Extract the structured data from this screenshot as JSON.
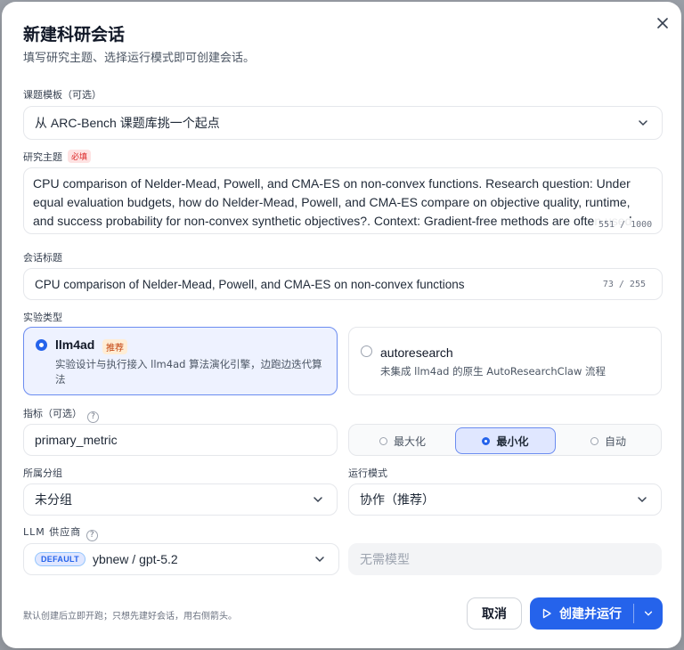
{
  "dialog": {
    "title": "新建科研会话",
    "subtitle": "填写研究主题、选择运行模式即可创建会话。"
  },
  "template": {
    "label": "课题模板（可选）",
    "value": "从 ARC-Bench 课题库挑一个起点"
  },
  "topic": {
    "label": "研究主题",
    "required": "必填",
    "text": "CPU comparison of Nelder-Mead, Powell, and CMA-ES on non-convex functions. Research question: Under equal evaluation budgets, how do Nelder-Mead, Powell, and CMA-ES compare on objective quality, runtime, and success probability for non-convex synthetic objectives?. Context: Gradient-free methods are often used when derivatives are unavailable or unreliable, and we need a reproducible comparison.",
    "counter": "551 / 1000"
  },
  "session_title": {
    "label": "会话标题",
    "value": "CPU comparison of Nelder-Mead, Powell, and CMA-ES on non-convex functions",
    "counter": "73 / 255"
  },
  "experiment": {
    "label": "实验类型",
    "options": [
      {
        "name": "llm4ad",
        "badge": "推荐",
        "desc": "实验设计与执行接入 llm4ad 算法演化引擎，边跑边迭代算法"
      },
      {
        "name": "autoresearch",
        "desc": "未集成 llm4ad 的原生 AutoResearchClaw 流程"
      }
    ],
    "selected": 0
  },
  "metric": {
    "label": "指标（可选）",
    "help": "?",
    "value": "primary_metric",
    "directions": [
      "最大化",
      "最小化",
      "自动"
    ],
    "selected_direction": 1
  },
  "group": {
    "label": "所属分组",
    "value": "未分组"
  },
  "run_mode": {
    "label": "运行模式",
    "value": "协作（推荐）"
  },
  "llm": {
    "label": "LLM 供应商",
    "help": "?",
    "badge": "DEFAULT",
    "value": "ybnew / gpt-5.2",
    "model_placeholder": "无需模型"
  },
  "footer": {
    "hint": "默认创建后立即开跑；只想先建好会话，用右侧箭头。",
    "cancel": "取消",
    "create": "创建并运行"
  },
  "colors": {
    "primary": "#2563eb",
    "selected_bg": "#eef2ff",
    "required": "#dc2626",
    "recommend": "#c2410c"
  }
}
